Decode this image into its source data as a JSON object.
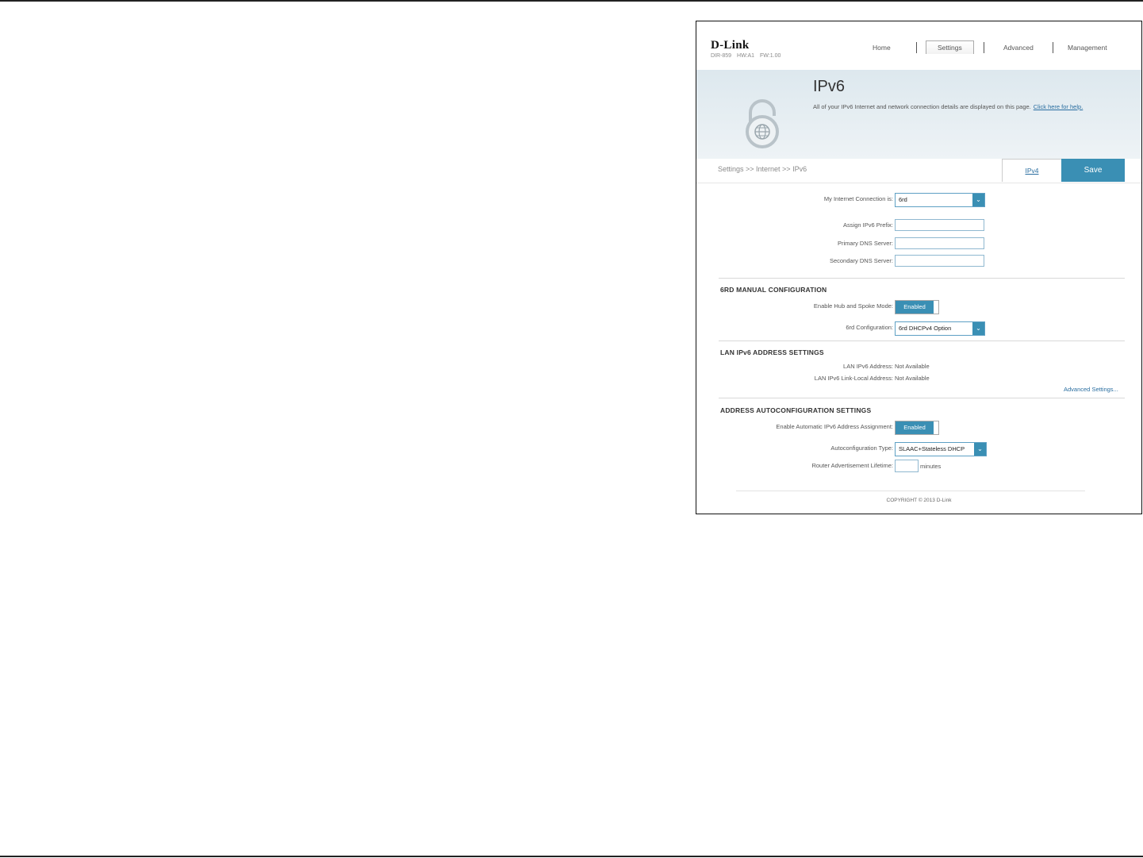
{
  "brand": {
    "logo": "D-Link",
    "model": "DIR-859",
    "hw_version": "HW:A1",
    "fw_version": "FW:1.00"
  },
  "nav": {
    "home": "Home",
    "settings": "Settings",
    "advanced": "Advanced",
    "management": "Management",
    "active": "Settings"
  },
  "banner": {
    "title": "IPv6",
    "description": "All of your IPv6 Internet and network connection details are displayed on this page.",
    "help_link": "Click here for help."
  },
  "breadcrumb": "Settings >> Internet >> IPv6",
  "actions": {
    "ipv4_link": "IPv4",
    "save": "Save"
  },
  "form": {
    "connection_label": "My Internet Connection is:",
    "connection_value": "6rd",
    "assign_prefix_label": "Assign IPv6 Prefix:",
    "assign_prefix_value": "",
    "primary_dns_label": "Primary DNS Server:",
    "primary_dns_value": "",
    "secondary_dns_label": "Secondary DNS Server:",
    "secondary_dns_value": ""
  },
  "manual_config": {
    "title": "6RD MANUAL CONFIGURATION",
    "hub_spoke_label": "Enable Hub and Spoke Mode:",
    "hub_spoke_value": "Enabled",
    "config_label": "6rd Configuration:",
    "config_value": "6rd DHCPv4 Option"
  },
  "lan_settings": {
    "title": "LAN IPv6 ADDRESS SETTINGS",
    "lan_address_label": "LAN IPv6 Address:",
    "lan_address_value": "Not Available",
    "link_local_label": "LAN IPv6 Link-Local Address:",
    "link_local_value": "Not Available",
    "advanced_link": "Advanced Settings..."
  },
  "autoconfig": {
    "title": "ADDRESS AUTOCONFIGURATION SETTINGS",
    "auto_assign_label": "Enable Automatic IPv6 Address Assignment:",
    "auto_assign_value": "Enabled",
    "type_label": "Autoconfiguration Type:",
    "type_value": "SLAAC+Stateless DHCP",
    "lifetime_label": "Router Advertisement Lifetime:",
    "lifetime_value": "",
    "lifetime_unit": "minutes"
  },
  "footer": "COPYRIGHT © 2013 D-Link",
  "colors": {
    "accent": "#3a8fb4",
    "link": "#2a6ea0",
    "banner": "#dde8ee"
  },
  "icons": {
    "lock": "ipv6-lock-icon",
    "dropdown": "chevron-down-icon"
  }
}
